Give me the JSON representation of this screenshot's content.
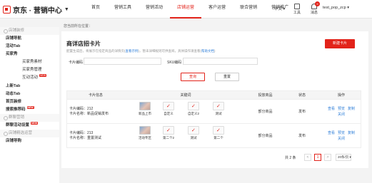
{
  "brand": {
    "name": "京东 · 营销中心"
  },
  "nav": [
    "首页",
    "营销工具",
    "营销活动",
    "店铺运营",
    "客户运营",
    "联合营销",
    "营销推广"
  ],
  "header": {
    "lang": "中文",
    "tools_label": "工具",
    "messages_label": "消息",
    "message_count": "9",
    "username": "test_pop_zcp"
  },
  "sidebar": {
    "g1": "店铺装修",
    "i_nav": "店铺导航",
    "i_activity_tab": "活动Tab",
    "i_buyer_show": "买家秀",
    "i_buyer_material": "买家秀素材",
    "i_buyer_manage": "买家秀管理",
    "i_interact": "互动活动",
    "i_new_tab": "上新Tab",
    "i_dynamic_tab": "动态Tab",
    "i_home": "首页装修",
    "i_search": "搜索推荐码",
    "g2": "群聊营销",
    "i_group": "群聊活动设置",
    "g3": "店铺精选运营",
    "i_shop": "店铺导购",
    "new_badge": "NEW"
  },
  "breadcrumb": "您当前所在位置：",
  "page": {
    "title": "商详店招卡片",
    "desc_prefix": "配置生成后，将展示在指定商品的详情页",
    "desc_link1": "查看示例",
    "desc_mid": "，暂未详细规则可供查阅，具体操作请查看",
    "desc_link2": "帮助文档",
    "new_button": "新建卡片"
  },
  "filters": {
    "card_code_label": "卡片编码",
    "card_code_placeholder": "",
    "sku_label": "SKU编码",
    "sku_placeholder": "",
    "search_button": "查询",
    "reset_button": "重置"
  },
  "table": {
    "headers": [
      "卡片信息",
      "关键词",
      "投放商品",
      "状态",
      "操作"
    ],
    "rows": [
      {
        "info_line1": "卡片编码：212",
        "info_line2": "卡片名称：新品促销发布",
        "products": [
          "新品上市",
          "自定义",
          "自定义2",
          "测试"
        ],
        "goods": "部分商品",
        "status": "发布",
        "ops_line1": [
          "查看",
          "预览",
          "复制"
        ],
        "ops_line2": [
          "关闭"
        ]
      },
      {
        "info_line1": "卡片编码：213",
        "info_line2": "卡片名称：重置测试",
        "products": [
          "活动专区",
          "第二个2",
          "测试",
          "第二个"
        ],
        "goods": "部分商品",
        "status": "发布",
        "ops_line1": [
          "查看",
          "预览",
          "复制"
        ],
        "ops_line2": [
          "关闭"
        ]
      }
    ]
  },
  "pager": {
    "total": "共 2 条",
    "prev": "<",
    "current": "1",
    "next": ">",
    "page_size": "20条/页"
  },
  "colors": {
    "accent": "#e2231a",
    "link": "#2e7ed8"
  }
}
